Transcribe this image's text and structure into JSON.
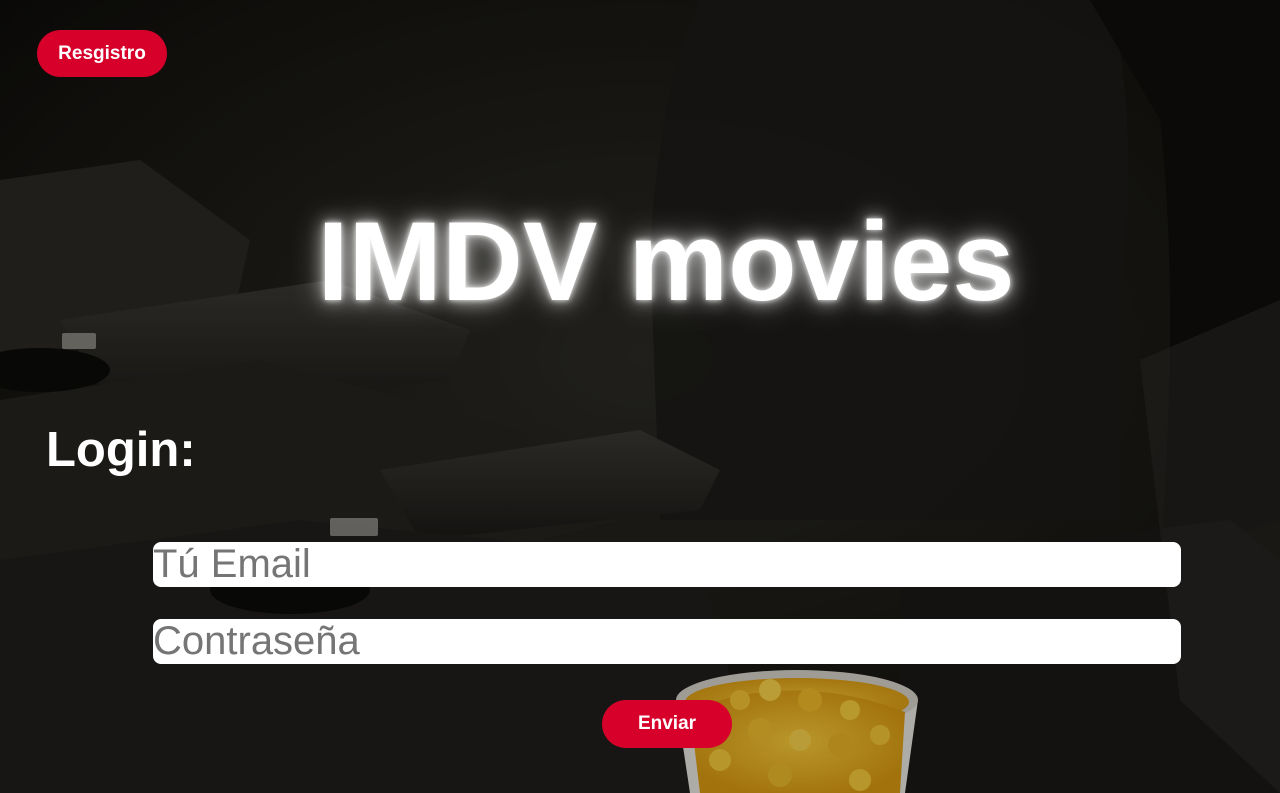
{
  "header": {
    "register_label": "Resgistro"
  },
  "hero": {
    "title": "IMDV movies"
  },
  "login": {
    "heading": "Login:",
    "email_placeholder": "Tú Email",
    "password_placeholder": "Contraseña",
    "submit_label": "Enviar"
  },
  "colors": {
    "accent": "#d6002a",
    "background": "#15130f",
    "text": "#ffffff"
  }
}
